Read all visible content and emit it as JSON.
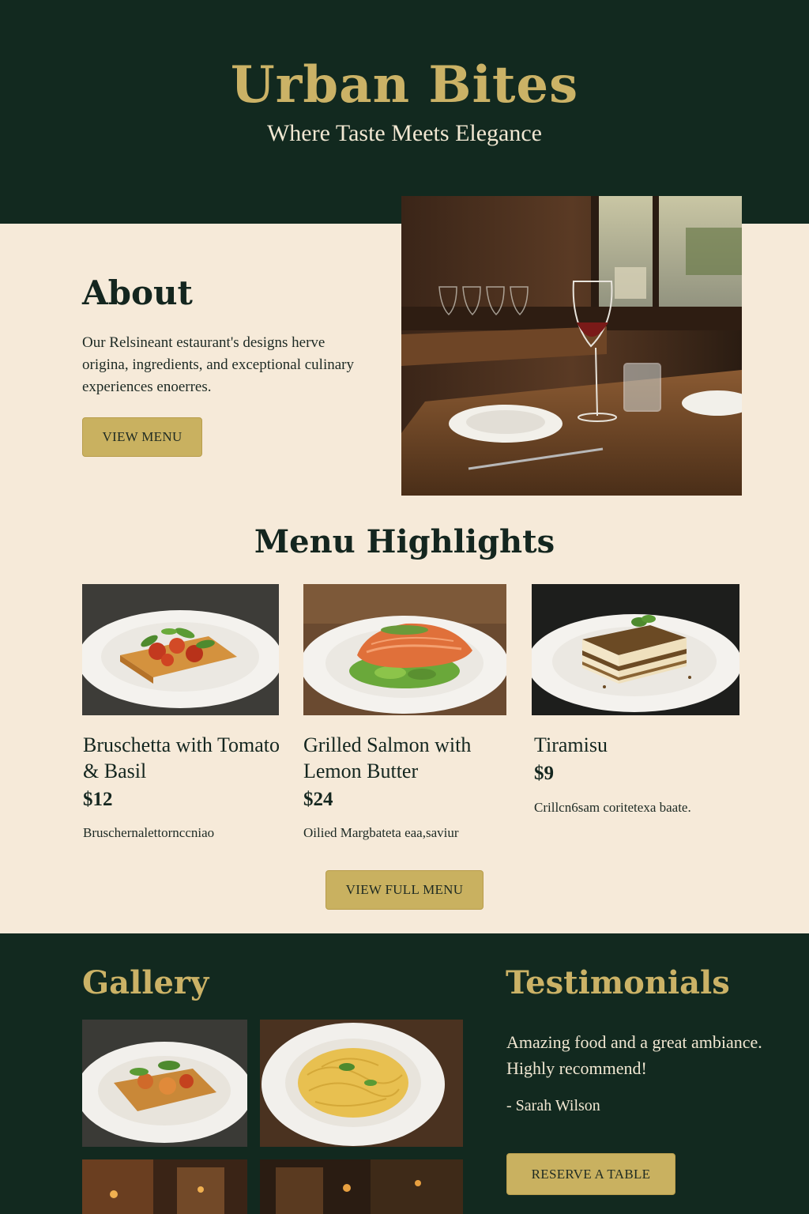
{
  "header": {
    "brand": "Urban Bites",
    "tagline": "Where Taste Meets Elegance"
  },
  "about": {
    "title": "About",
    "text": "Our Relsineant estaurant's designs herve origina, ingredients, and exceptional culinary experiences enoerres.",
    "button_label": "VIEW MENU"
  },
  "menu": {
    "title": "Menu Highlights",
    "items": [
      {
        "name": "Bruschetta with Tomato & Basil",
        "price": "$12",
        "description": "Bruschernalettornccniao"
      },
      {
        "name": "Grilled Salmon with Lemon Butter",
        "price": "$24",
        "description": "Oilied Margbateta eaa,saviur"
      },
      {
        "name": "Tiramisu",
        "price": "$9",
        "description": "Crillcn6sam coritetexa baate."
      }
    ],
    "button_label": "VIEW FULL MENU"
  },
  "gallery": {
    "title": "Gallery"
  },
  "testimonials": {
    "title": "Testimonials",
    "quote": "Amazing food and a great ambiance. Highly recommend!",
    "author": "- Sarah Wilson",
    "button_label": "RESERVE A TABLE"
  },
  "colors": {
    "dark_green": "#12291f",
    "gold": "#cbb266",
    "cream": "#f6ead9"
  },
  "images": {
    "hero": "restaurant-interior-wine-glass",
    "dishes": [
      "bruschetta-plate",
      "grilled-salmon-plate",
      "tiramisu-plate"
    ],
    "gallery": [
      "bruschetta-plate",
      "spaghetti-plate",
      "restaurant-interior",
      "restaurant-bar"
    ]
  }
}
